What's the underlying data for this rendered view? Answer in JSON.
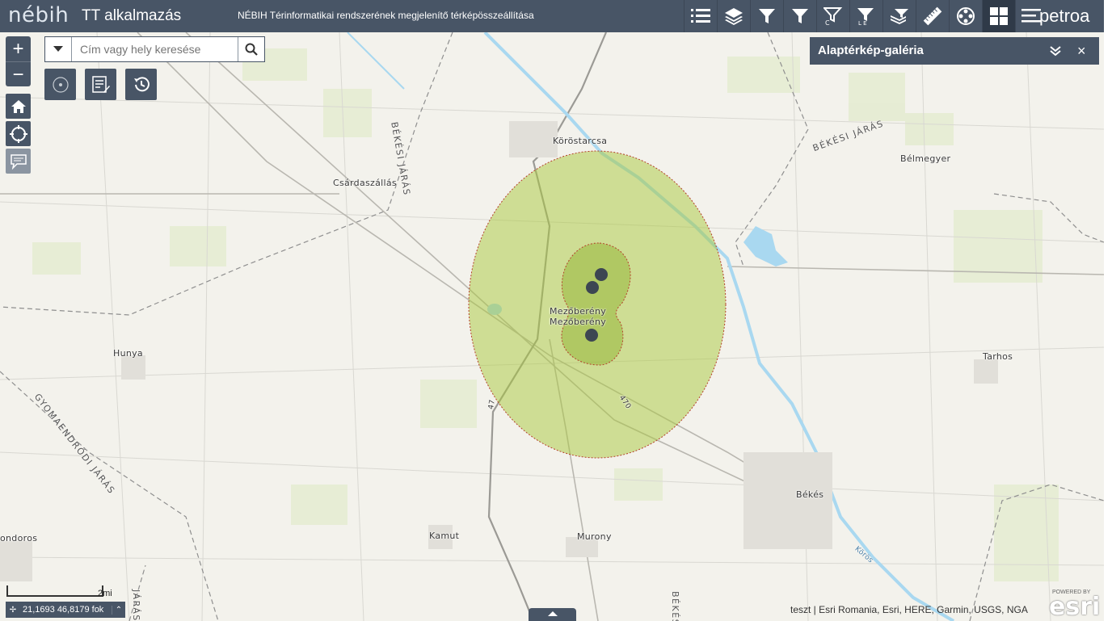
{
  "header": {
    "logo_text": "nébih",
    "app_title": "TT alkalmazás",
    "subtitle": "NÉBIH Térinformatikai rendszerének megjelenítő térképösszeállítása",
    "brand": "petroa",
    "tools": [
      {
        "icon": "list-icon"
      },
      {
        "icon": "layers-icon"
      },
      {
        "icon": "filter-icon"
      },
      {
        "icon": "filter-icon"
      },
      {
        "icon": "filter-c-icon"
      },
      {
        "icon": "filter-le-icon"
      },
      {
        "icon": "layer-filter-icon"
      },
      {
        "icon": "ruler-icon"
      },
      {
        "icon": "film-reel-icon"
      },
      {
        "icon": "basemap-gallery-icon",
        "active": true
      },
      {
        "icon": "menu-icon"
      }
    ]
  },
  "search": {
    "placeholder": "Cím vagy hely keresése"
  },
  "zoom": {
    "in_label": "+",
    "out_label": "−"
  },
  "gallery_panel": {
    "title": "Alaptérkép-galéria",
    "close_label": "×"
  },
  "map": {
    "places": [
      {
        "name": "Köröstarcsa"
      },
      {
        "name": "Csárdaszállás"
      },
      {
        "name": "Bélmegyer"
      },
      {
        "name": "Hunya"
      },
      {
        "name": "Tarhos"
      },
      {
        "name": "Mezőberény"
      },
      {
        "name": "Mezőberény"
      },
      {
        "name": "Békés"
      },
      {
        "name": "Kamut"
      },
      {
        "name": "Murony"
      },
      {
        "name": "ondoros"
      }
    ],
    "districts": [
      {
        "name": "BÉKÉSI JÁRÁS"
      },
      {
        "name": "BÉKÉSI JÁRÁS"
      },
      {
        "name": "GYOMAENDRŐDI JÁRÁS"
      },
      {
        "name": "JÁRÁS"
      },
      {
        "name": "BÉKÉS"
      }
    ],
    "roads": [
      "470",
      "47"
    ],
    "river": "Körös",
    "colors": {
      "buffer_fill": "#a9c83c",
      "buffer_outline": "#b5402a",
      "points": "#3d4652",
      "water": "#a9d8f0",
      "ui": "#485566"
    }
  },
  "bottom": {
    "scale_label": "2mi",
    "coordinates": "21,1693 46,8179 fok",
    "attribution": "teszt | Esri Romania, Esri, HERE, Garmin, USGS, NGA",
    "esri_powered": "POWERED BY",
    "esri_word": "esri"
  }
}
